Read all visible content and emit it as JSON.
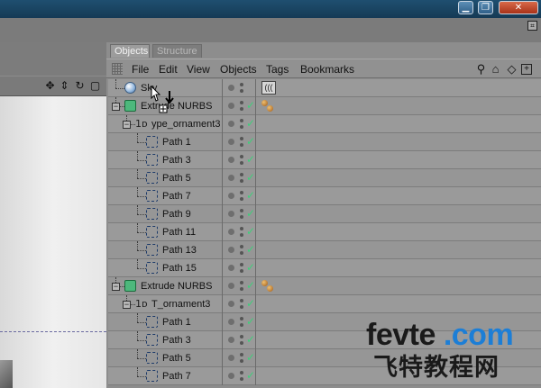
{
  "window": {
    "minimize_glyph": "▁",
    "restore_glyph": "❐",
    "close_glyph": "✕"
  },
  "object_manager": {
    "tabs": [
      {
        "label": "Objects",
        "active": true
      },
      {
        "label": "Structure",
        "active": false
      }
    ],
    "menu": [
      "File",
      "Edit",
      "View",
      "Objects",
      "Tags",
      "Bookmarks"
    ],
    "toolbar_icons": [
      "search-icon",
      "home-icon",
      "eye-icon",
      "new-window-icon"
    ],
    "rows": [
      {
        "label": "Sky",
        "icon": "sky-icon",
        "depth": 0,
        "expander": "",
        "check": false,
        "tag": "sky-tag"
      },
      {
        "label": "Extrude NURBS",
        "icon": "extrude-nurbs-icon",
        "depth": 0,
        "expander": "−",
        "check": true,
        "tag": "material-tag"
      },
      {
        "label": "ype_ornament3",
        "icon": "spline-text-icon",
        "depth": 1,
        "expander": "−",
        "check": true,
        "tag": ""
      },
      {
        "label": "Path 1",
        "icon": "path-spline-icon",
        "depth": 2,
        "expander": "",
        "check": true,
        "tag": ""
      },
      {
        "label": "Path 3",
        "icon": "path-spline-icon",
        "depth": 2,
        "expander": "",
        "check": true,
        "tag": ""
      },
      {
        "label": "Path 5",
        "icon": "path-spline-icon",
        "depth": 2,
        "expander": "",
        "check": true,
        "tag": ""
      },
      {
        "label": "Path 7",
        "icon": "path-spline-icon",
        "depth": 2,
        "expander": "",
        "check": true,
        "tag": ""
      },
      {
        "label": "Path 9",
        "icon": "path-spline-icon",
        "depth": 2,
        "expander": "",
        "check": true,
        "tag": ""
      },
      {
        "label": "Path 11",
        "icon": "path-spline-icon",
        "depth": 2,
        "expander": "",
        "check": true,
        "tag": ""
      },
      {
        "label": "Path 13",
        "icon": "path-spline-icon",
        "depth": 2,
        "expander": "",
        "check": true,
        "tag": ""
      },
      {
        "label": "Path 15",
        "icon": "path-spline-icon",
        "depth": 2,
        "expander": "",
        "check": true,
        "tag": ""
      },
      {
        "label": "Extrude NURBS",
        "icon": "extrude-nurbs-icon",
        "depth": 0,
        "expander": "−",
        "check": true,
        "tag": "material-tag"
      },
      {
        "label": "T_ornament3",
        "icon": "spline-text-icon",
        "depth": 1,
        "expander": "−",
        "check": true,
        "tag": ""
      },
      {
        "label": "Path 1",
        "icon": "path-spline-icon",
        "depth": 2,
        "expander": "",
        "check": true,
        "tag": ""
      },
      {
        "label": "Path 3",
        "icon": "path-spline-icon",
        "depth": 2,
        "expander": "",
        "check": true,
        "tag": ""
      },
      {
        "label": "Path 5",
        "icon": "path-spline-icon",
        "depth": 2,
        "expander": "",
        "check": true,
        "tag": ""
      },
      {
        "label": "Path 7",
        "icon": "path-spline-icon",
        "depth": 2,
        "expander": "",
        "check": true,
        "tag": ""
      }
    ],
    "check_glyph": "✓",
    "spline_glyph": "1ᴅ"
  },
  "viewport": {
    "nav_icons": [
      "move-icon",
      "zoom-icon",
      "rotate-icon",
      "maximize-icon"
    ]
  },
  "watermark": {
    "line1_a": "fevte",
    "line1_b": " .com",
    "line2": "飞特教程网"
  },
  "colors": {
    "check": "#3ed07a",
    "extrude_icon": "#4db87c",
    "watermark_accent": "#1c7ed6"
  }
}
